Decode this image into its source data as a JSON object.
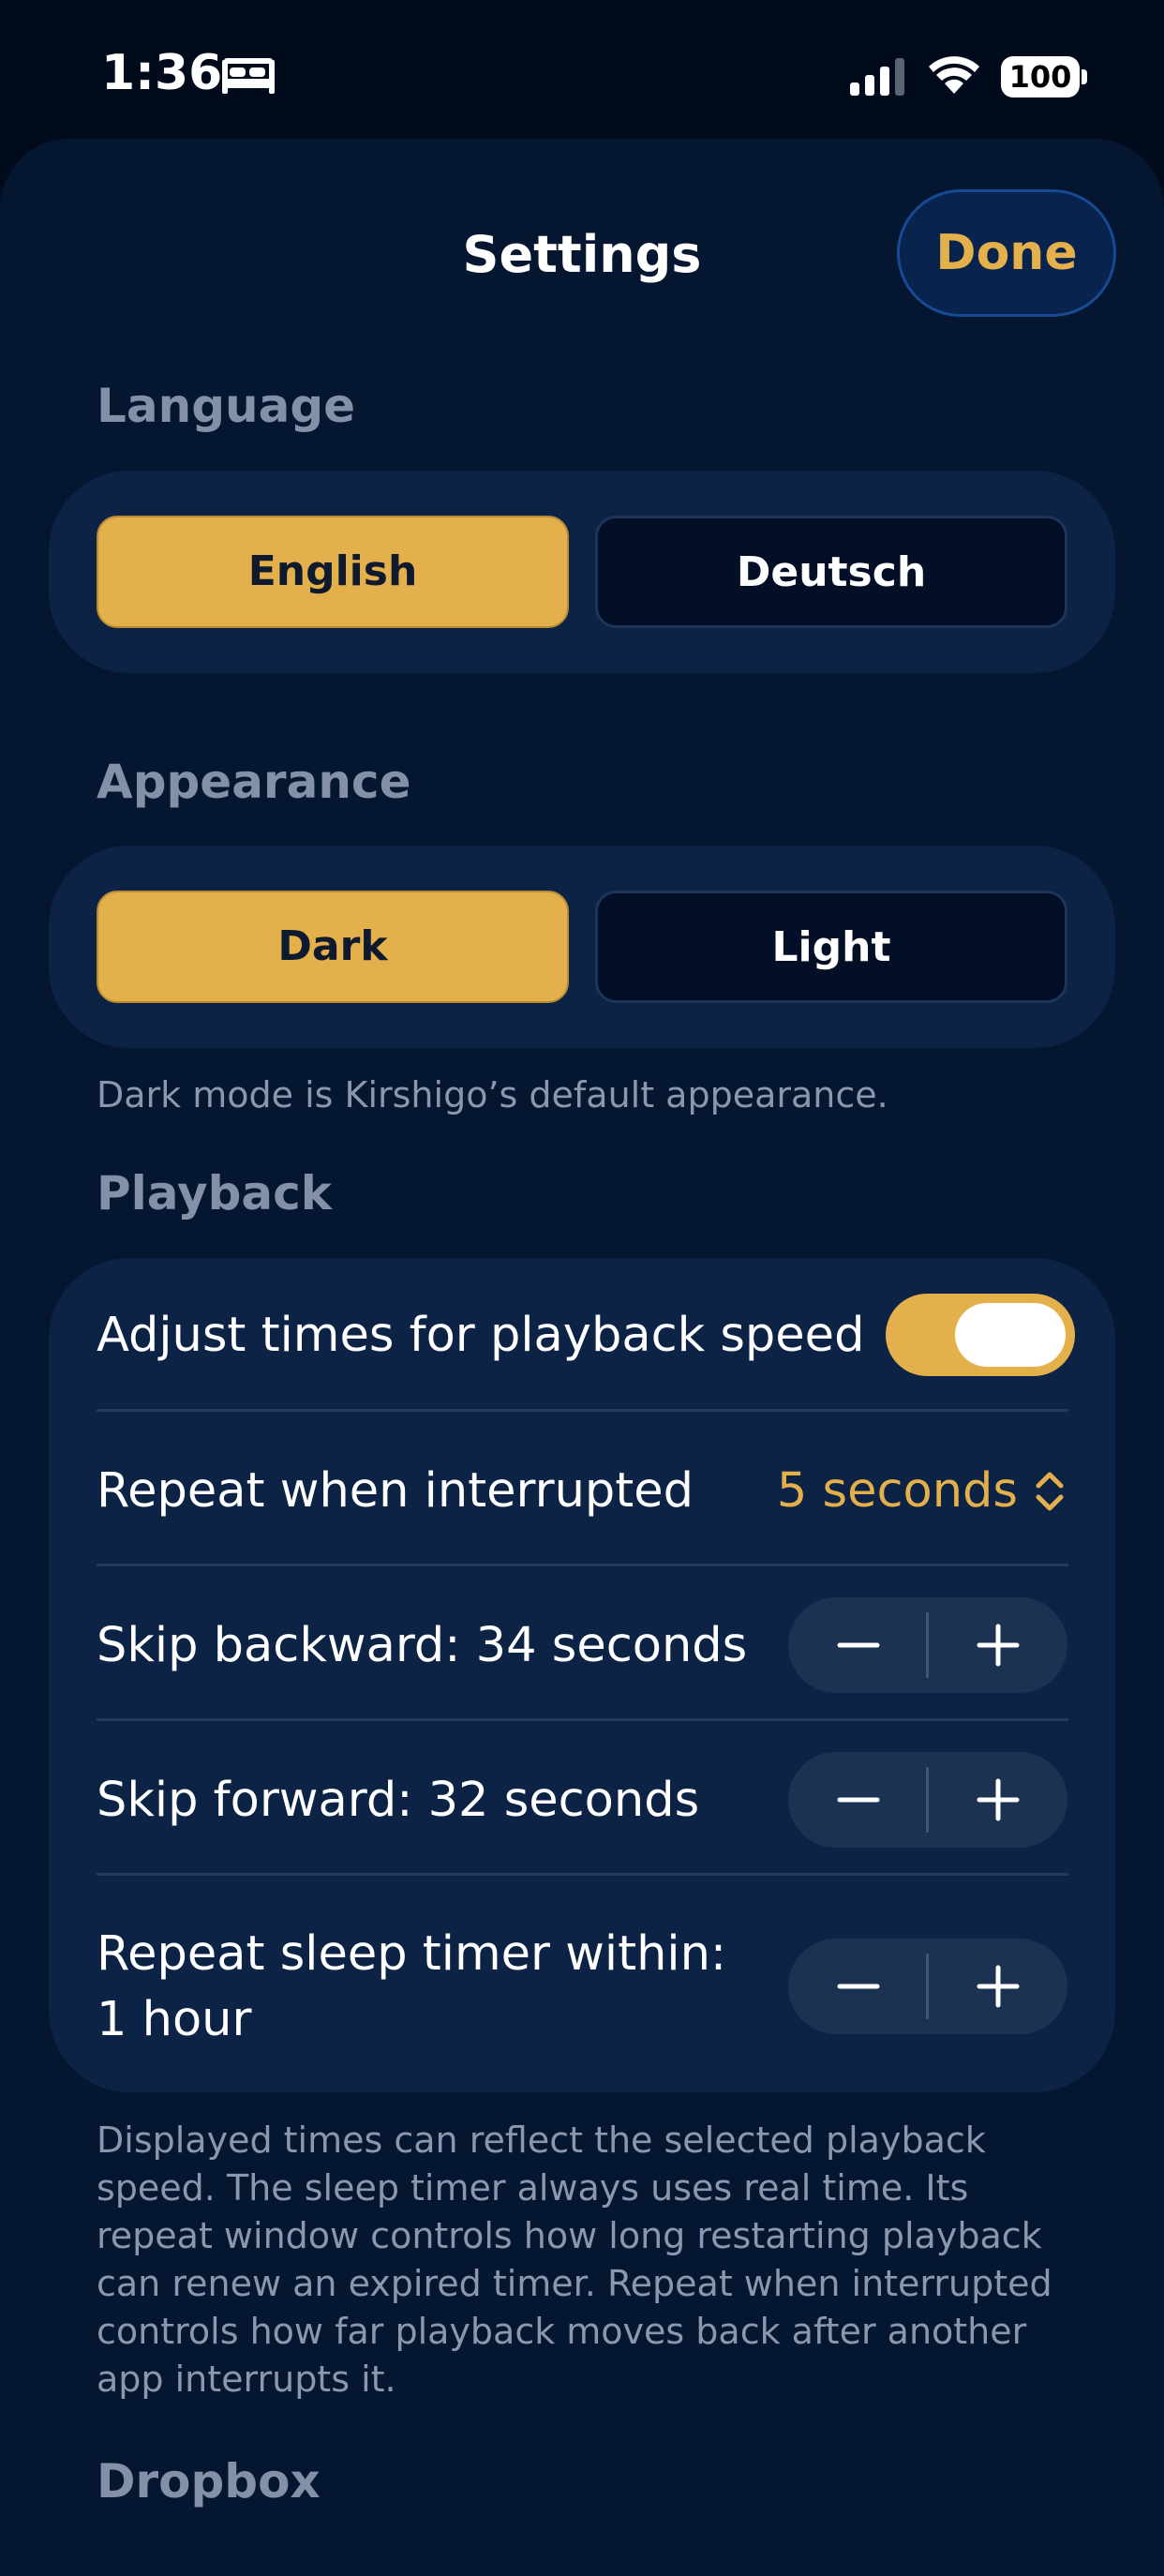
{
  "status_bar": {
    "time": "1:36",
    "battery": "100"
  },
  "nav": {
    "title": "Settings",
    "done_label": "Done"
  },
  "language": {
    "header": "Language",
    "options": [
      "English",
      "Deutsch"
    ],
    "selected": "English"
  },
  "appearance": {
    "header": "Appearance",
    "options": [
      "Dark",
      "Light"
    ],
    "selected": "Dark",
    "footnote": "Dark mode is Kirshigo’s default appearance."
  },
  "playback": {
    "header": "Playback",
    "adjust_times_label": "Adjust times for playback speed",
    "adjust_times_enabled": true,
    "repeat_interrupted_label": "Repeat when interrupted",
    "repeat_interrupted_value": "5 seconds",
    "skip_backward_label": "Skip backward: 34 seconds",
    "skip_forward_label": "Skip forward: 32 seconds",
    "sleep_timer_label_line1": "Repeat sleep timer within:",
    "sleep_timer_label_line2": "1 hour",
    "footnote_lines": [
      "Displayed times can reflect the selected playback",
      "speed. The sleep timer always uses real time. Its",
      "repeat window controls how long restarting playback",
      "can renew an expired timer. Repeat when interrupted",
      "controls how far playback moves back after another",
      "app interrupts it."
    ]
  },
  "dropbox": {
    "header": "Dropbox"
  },
  "colors": {
    "accent": "#e3b04b",
    "background": "#020b1c",
    "sheet": "#051631",
    "card": "#0c2346",
    "secondary_text": "#8390a7"
  },
  "icons": {
    "status": [
      "bed-icon",
      "signal-icon",
      "wifi-icon",
      "battery-icon"
    ],
    "picker": "chevron-updown-icon",
    "stepper": [
      "minus-icon",
      "plus-icon"
    ]
  }
}
